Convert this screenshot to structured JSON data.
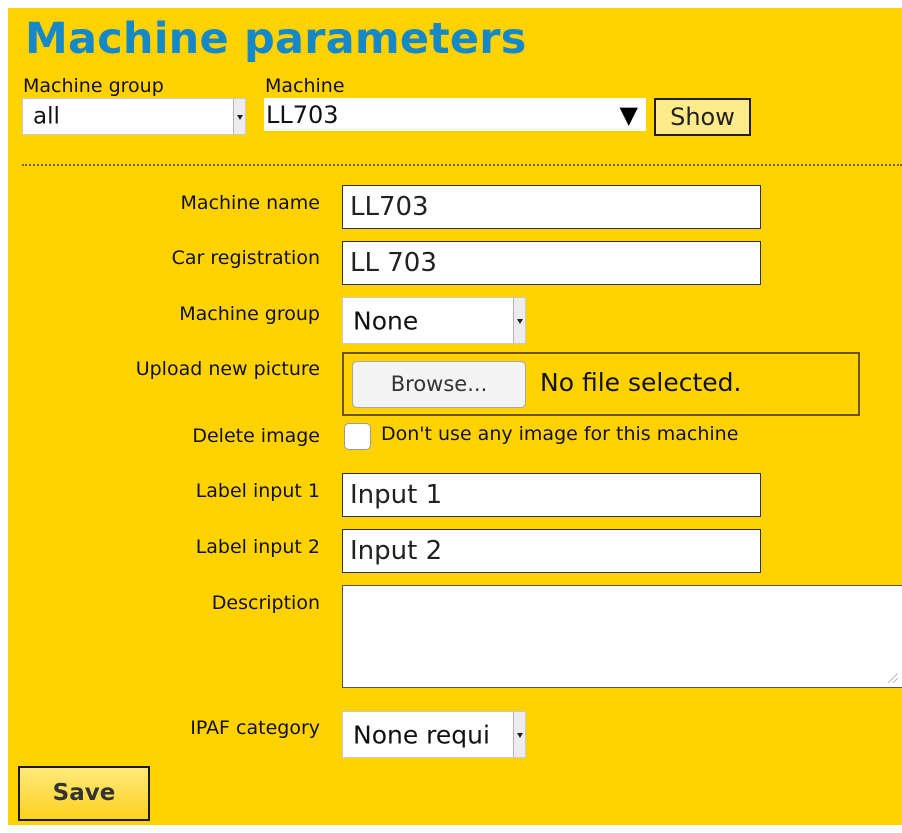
{
  "page": {
    "title": "Machine parameters"
  },
  "filter": {
    "group_label": "Machine group",
    "group_value": "all",
    "machine_label": "Machine",
    "machine_value": "LL703",
    "show_label": "Show"
  },
  "form": {
    "machine_name_label": "Machine name",
    "machine_name_value": "LL703",
    "car_registration_label": "Car registration",
    "car_registration_value": "LL 703",
    "machine_group_label": "Machine group",
    "machine_group_value": "None",
    "upload_label": "Upload new picture",
    "browse_label": "Browse...",
    "file_status": "No file selected.",
    "delete_image_label": "Delete image",
    "delete_image_checkbox_label": "Don't use any image for this machine",
    "label_input_1_label": "Label input 1",
    "label_input_1_value": "Input 1",
    "label_input_2_label": "Label input 2",
    "label_input_2_value": "Input 2",
    "description_label": "Description",
    "description_value": "",
    "ipaf_label": "IPAF category",
    "ipaf_value": "None requi",
    "save_label": "Save"
  },
  "icons": {
    "small_dropdown": "chevron-down-icon",
    "large_dropdown": "triangle-down-icon"
  },
  "colors": {
    "background": "#ffd200",
    "title": "#1588c7"
  }
}
